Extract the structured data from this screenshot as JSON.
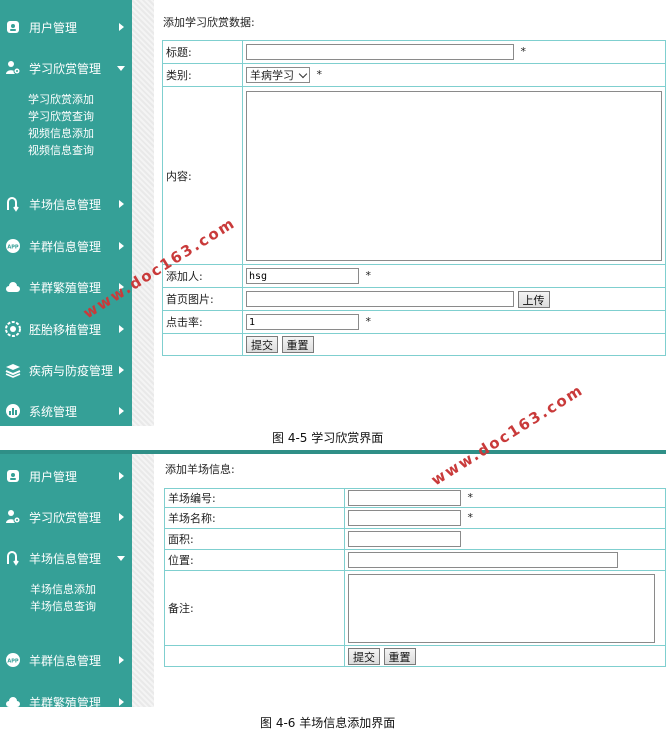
{
  "screen1": {
    "sidebar": {
      "items": [
        {
          "label": "用户管理",
          "icon": "user-card-icon"
        },
        {
          "label": "学习欣赏管理",
          "icon": "user-gear-icon",
          "expanded": true
        },
        {
          "label": "羊场信息管理",
          "icon": "u-turn-arrows-icon"
        },
        {
          "label": "羊群信息管理",
          "icon": "app-badge-icon"
        },
        {
          "label": "羊群繁殖管理",
          "icon": "cloud-icon"
        },
        {
          "label": "胚胎移植管理",
          "icon": "settings-ring-icon"
        },
        {
          "label": "疾病与防疫管理",
          "icon": "layers-icon"
        },
        {
          "label": "系统管理",
          "icon": "bar-chart-icon"
        }
      ],
      "subitems": [
        "学习欣赏添加",
        "学习欣赏查询",
        "视频信息添加",
        "视频信息查询"
      ]
    },
    "heading": "添加学习欣赏数据:",
    "form": {
      "title_label": "标题:",
      "title_value": "",
      "category_label": "类别:",
      "category_value": "羊病学习",
      "content_label": "内容:",
      "adder_label": "添加人:",
      "adder_value": "hsg",
      "image_label": "首页图片:",
      "upload_button": "上传",
      "clicks_label": "点击率:",
      "clicks_value": "1",
      "submit_button": "提交",
      "reset_button": "重置",
      "required_mark": "*"
    },
    "caption": "图 4-5  学习欣赏界面"
  },
  "screen2": {
    "sidebar": {
      "items": [
        {
          "label": "用户管理",
          "icon": "user-card-icon"
        },
        {
          "label": "学习欣赏管理",
          "icon": "user-gear-icon"
        },
        {
          "label": "羊场信息管理",
          "icon": "u-turn-arrows-icon",
          "expanded": true
        },
        {
          "label": "羊群信息管理",
          "icon": "app-badge-icon"
        },
        {
          "label": "羊群繁殖管理",
          "icon": "cloud-icon"
        }
      ],
      "subitems": [
        "羊场信息添加",
        "羊场信息查询"
      ]
    },
    "heading": "添加羊场信息:",
    "form": {
      "code_label": "羊场编号:",
      "name_label": "羊场名称:",
      "area_label": "面积:",
      "location_label": "位置:",
      "notes_label": "备注:",
      "submit_button": "提交",
      "reset_button": "重置",
      "required_mark": "*"
    },
    "caption": "图 4-6  羊场信息添加界面"
  },
  "watermark": "www.doc163.com",
  "colors": {
    "sidebar": "#35a097",
    "topbar": "#2f8f87",
    "table_border": "#7fcfcf",
    "watermark": "#c93a3a"
  }
}
